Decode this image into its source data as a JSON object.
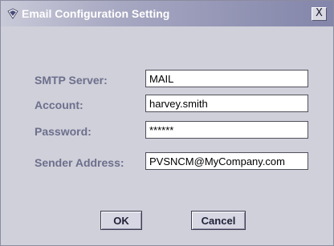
{
  "dialog": {
    "title": "Email Configuration Setting",
    "close_glyph": "X",
    "icon": "shield-logo-icon"
  },
  "form": {
    "smtp_server": {
      "label": "SMTP Server:",
      "value": "MAIL"
    },
    "account": {
      "label": "Account:",
      "value": "harvey.smith"
    },
    "password": {
      "label": "Password:",
      "value": "******"
    },
    "sender_address": {
      "label": "Sender Address:",
      "value": "PVSNCM@MyCompany.com"
    }
  },
  "buttons": {
    "ok_label": "OK",
    "cancel_label": "Cancel"
  },
  "colors": {
    "title_bar_start": "#c9cad8",
    "title_bar_end": "#8385aa",
    "dialog_background": "#cfd0d9",
    "label_text": "#6d6f8d"
  }
}
